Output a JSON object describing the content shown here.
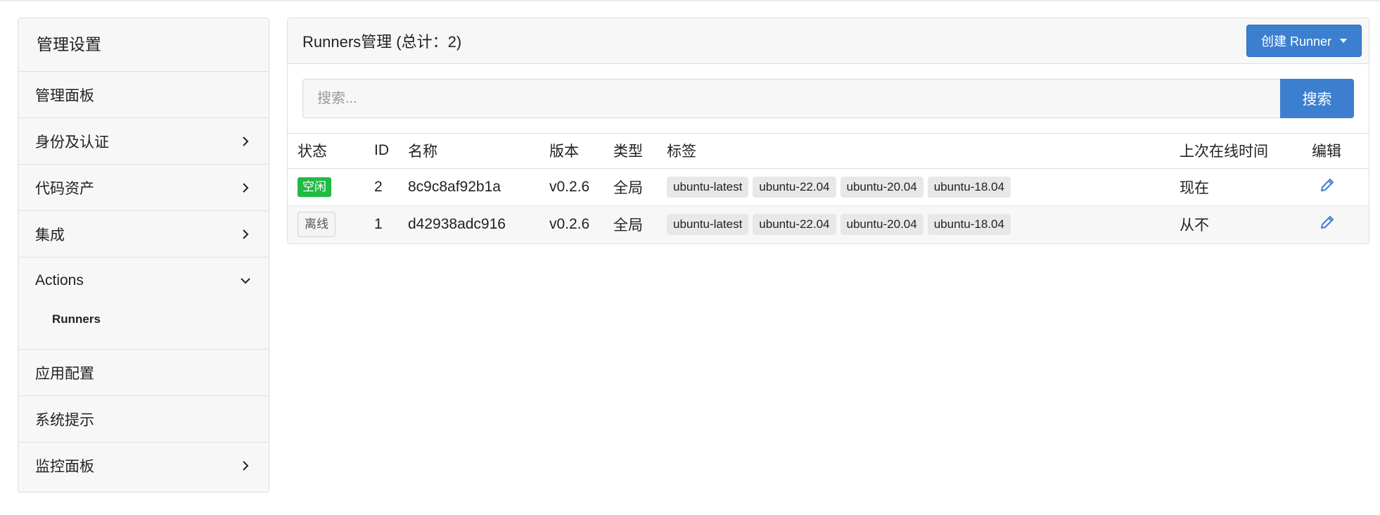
{
  "sidebar": {
    "title": "管理设置",
    "items": [
      {
        "label": "管理面板",
        "chevron": false
      },
      {
        "label": "身份及认证",
        "chevron": "right"
      },
      {
        "label": "代码资产",
        "chevron": "right"
      },
      {
        "label": "集成",
        "chevron": "right"
      },
      {
        "label": "Actions",
        "chevron": "down",
        "subitems": [
          {
            "label": "Runners"
          }
        ]
      },
      {
        "label": "应用配置",
        "chevron": false
      },
      {
        "label": "系统提示",
        "chevron": false
      },
      {
        "label": "监控面板",
        "chevron": "right"
      }
    ]
  },
  "header": {
    "title": "Runners管理 (总计：2)",
    "create_label": "创建 Runner"
  },
  "search": {
    "placeholder": "搜索...",
    "button_label": "搜索"
  },
  "table": {
    "columns": [
      "状态",
      "ID",
      "名称",
      "版本",
      "类型",
      "标签",
      "上次在线时间",
      "编辑"
    ],
    "rows": [
      {
        "status": "空闲",
        "status_kind": "idle",
        "id": "2",
        "name": "8c9c8af92b1a",
        "version": "v0.2.6",
        "type": "全局",
        "tags": [
          "ubuntu-latest",
          "ubuntu-22.04",
          "ubuntu-20.04",
          "ubuntu-18.04"
        ],
        "last_online": "现在"
      },
      {
        "status": "离线",
        "status_kind": "offline",
        "id": "1",
        "name": "d42938adc916",
        "version": "v0.2.6",
        "type": "全局",
        "tags": [
          "ubuntu-latest",
          "ubuntu-22.04",
          "ubuntu-20.04",
          "ubuntu-18.04"
        ],
        "last_online": "从不"
      }
    ]
  },
  "colors": {
    "primary": "#3d7fcf",
    "idle_badge": "#21ba45",
    "sidebar_bg": "#f7f7f7",
    "edit_icon": "#3d7fcf"
  },
  "icons": {
    "chevron_right": "chevron-right-icon",
    "chevron_down": "chevron-down-icon",
    "edit": "pencil-icon",
    "dropdown": "caret-down-icon"
  }
}
